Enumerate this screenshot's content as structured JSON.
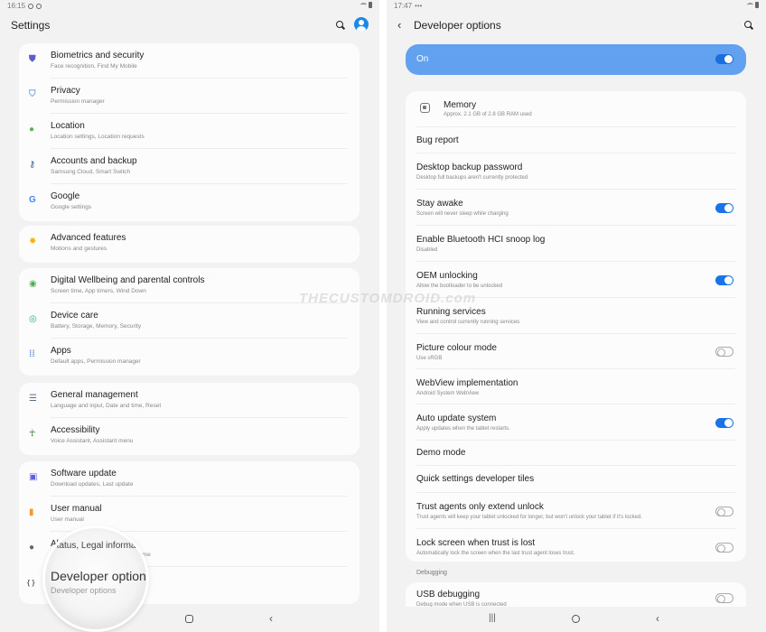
{
  "left": {
    "statusbar": {
      "time": "16:15"
    },
    "appbar": {
      "title": "Settings"
    },
    "groups": [
      [
        {
          "label": "Biometrics and security",
          "sub": "Face recognition, Find My Mobile",
          "icon": "shield-icon",
          "color": "#5b5fc7"
        },
        {
          "label": "Privacy",
          "sub": "Permission manager",
          "icon": "privacy-shield-icon",
          "color": "#7a9ee6"
        },
        {
          "label": "Location",
          "sub": "Location settings, Location requests",
          "icon": "location-pin-icon",
          "color": "#5fb15a"
        },
        {
          "label": "Accounts and backup",
          "sub": "Samsung Cloud, Smart Switch",
          "icon": "key-icon",
          "color": "#3c5fb5"
        },
        {
          "label": "Google",
          "sub": "Google settings",
          "icon": "google-icon",
          "color": "#4285f4"
        }
      ],
      [
        {
          "label": "Advanced features",
          "sub": "Motions and gestures",
          "icon": "gear-plus-icon",
          "color": "#f4b400"
        }
      ],
      [
        {
          "label": "Digital Wellbeing and parental controls",
          "sub": "Screen time, App timers, Wind Down",
          "icon": "wellbeing-icon",
          "color": "#4caf50"
        },
        {
          "label": "Device care",
          "sub": "Battery, Storage, Memory, Security",
          "icon": "device-care-icon",
          "color": "#26a69a"
        },
        {
          "label": "Apps",
          "sub": "Default apps, Permission manager",
          "icon": "apps-grid-icon",
          "color": "#5c8fd6"
        }
      ],
      [
        {
          "label": "General management",
          "sub": "Language and input, Date and time, Reset",
          "icon": "sliders-icon",
          "color": "#5a6e8c"
        },
        {
          "label": "Accessibility",
          "sub": "Voice Assistant, Assistant menu",
          "icon": "accessibility-icon",
          "color": "#2e7d32"
        }
      ],
      [
        {
          "label": "Software update",
          "sub": "Download updates, Last update",
          "icon": "software-update-icon",
          "color": "#5c5fd6"
        },
        {
          "label": "User manual",
          "sub": "User manual",
          "icon": "user-manual-icon",
          "color": "#f29a2e"
        },
        {
          "label": "About tablet",
          "sub": "Status, Legal information, Tablet name",
          "icon": "info-icon",
          "color": "#666666"
        },
        {
          "label": "Developer options",
          "sub": "Developer options",
          "icon": "code-braces-icon",
          "color": "#666666"
        }
      ]
    ],
    "magnifier": {
      "top_label": "Status, Legal informa",
      "label": "Developer options",
      "sub": "Developer options"
    }
  },
  "right": {
    "statusbar": {
      "time": "17:47"
    },
    "appbar": {
      "title": "Developer options"
    },
    "master": {
      "label": "On",
      "on": true
    },
    "memory": {
      "label": "Memory",
      "sub": "Approx. 2.1 GB of 2.8 GB RAM used"
    },
    "items": [
      {
        "label": "Bug report",
        "sub": ""
      },
      {
        "label": "Desktop backup password",
        "sub": "Desktop full backups aren't currently protected"
      },
      {
        "label": "Stay awake",
        "sub": "Screen will never sleep while charging",
        "toggle": "on"
      },
      {
        "label": "Enable Bluetooth HCI snoop log",
        "sub": "Disabled"
      },
      {
        "label": "OEM unlocking",
        "sub": "Allow the bootloader to be unlocked",
        "toggle": "on"
      },
      {
        "label": "Running services",
        "sub": "View and control currently running services"
      },
      {
        "label": "Picture colour mode",
        "sub": "Use sRGB",
        "toggle": "off"
      },
      {
        "label": "WebView implementation",
        "sub": "Android System WebView"
      },
      {
        "label": "Auto update system",
        "sub": "Apply updates when the tablet restarts.",
        "toggle": "on"
      },
      {
        "label": "Demo mode",
        "sub": ""
      },
      {
        "label": "Quick settings developer tiles",
        "sub": ""
      },
      {
        "label": "Trust agents only extend unlock",
        "sub": "Trust agents will keep your tablet unlocked for longer, but won't unlock your tablet if it's locked.",
        "toggle": "off"
      },
      {
        "label": "Lock screen when trust is lost",
        "sub": "Automatically lock the screen when the last trust agent loses trust.",
        "toggle": "off"
      }
    ],
    "section": "Debugging",
    "usb": {
      "label": "USB debugging",
      "sub": "Debug mode when USB is connected",
      "toggle": "off"
    }
  },
  "watermark": "THECUSTOMDROID.com",
  "colors": {
    "accent": "#1a73e8",
    "master_bg": "#62a0f0",
    "bg": "#f2f2f2",
    "card": "#fcfcfc"
  }
}
